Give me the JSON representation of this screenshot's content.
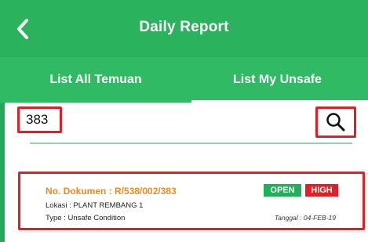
{
  "header": {
    "title": "Daily Report",
    "back_icon": "chevron-left-icon"
  },
  "tabs": [
    {
      "label": "List All Temuan",
      "active": false
    },
    {
      "label": "List My Unsafe",
      "active": true
    }
  ],
  "search": {
    "value": "383",
    "icon": "search-icon"
  },
  "results": [
    {
      "doc_prefix": "No. Dokumen : ",
      "doc_number": "R/538/002/383",
      "location_label": "Lokasi : ",
      "location": "PLANT REMBANG 1",
      "type_label": "Type : ",
      "type": "Unsafe Condition",
      "status": "OPEN",
      "priority": "HIGH",
      "date_label": "Tanggal : ",
      "date": "04-FEB-19"
    }
  ],
  "colors": {
    "primary": "#2ab35c",
    "tab_bar": "#30ba64",
    "highlight": "#e31e24",
    "doc_number": "#f08a1d",
    "open_badge": "#1fb157",
    "high_badge": "#e31e24"
  }
}
